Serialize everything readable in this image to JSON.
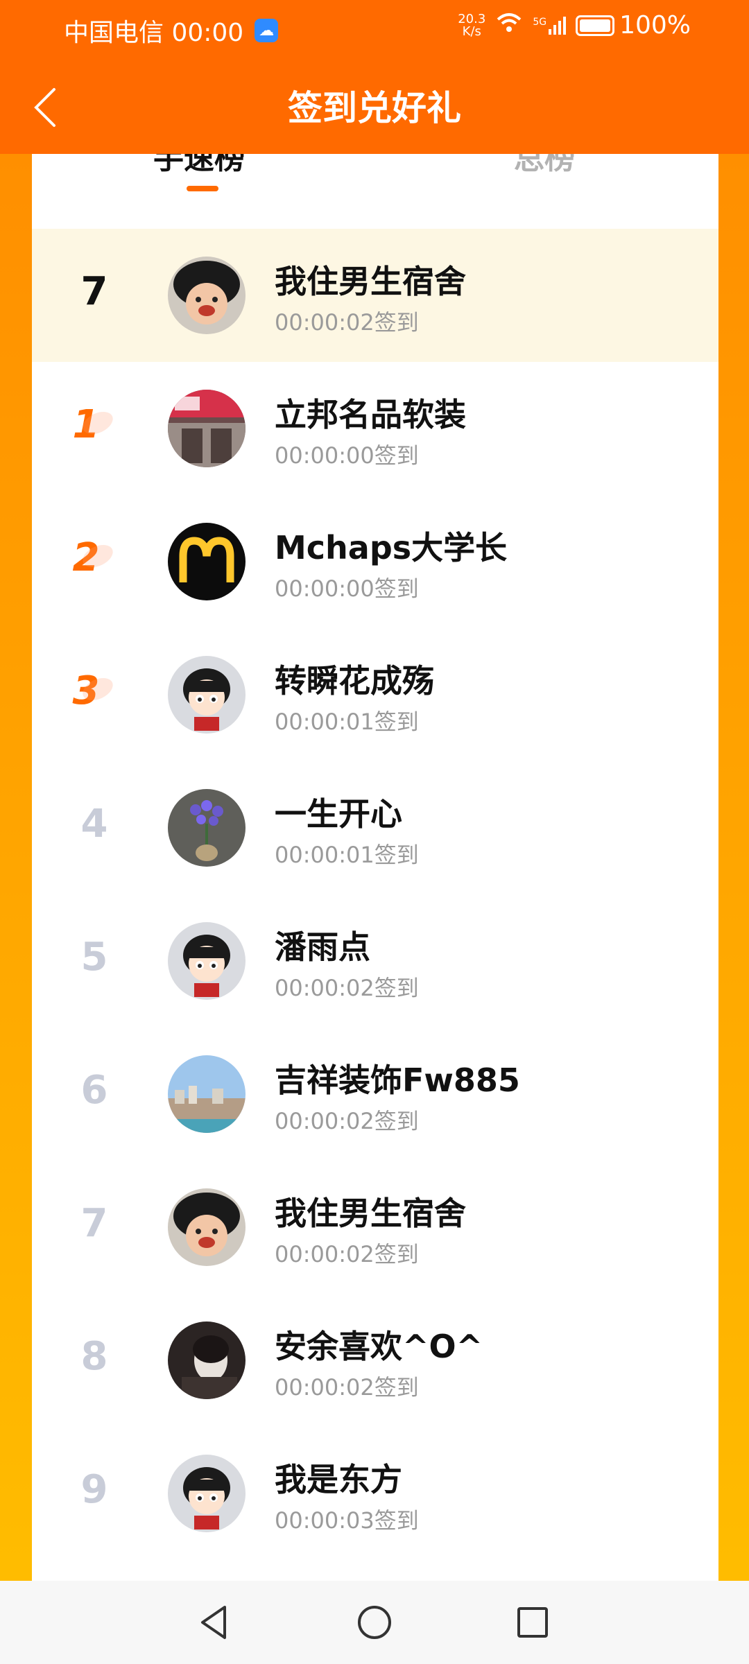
{
  "status_bar": {
    "carrier_time": "中国电信 00:00",
    "net_speed_top": "20.3",
    "net_speed_bottom": "K/s",
    "network_type": "5G",
    "battery": "100%"
  },
  "header": {
    "title": "签到兑好礼"
  },
  "tabs": [
    {
      "label": "手速榜",
      "active": true
    },
    {
      "label": "总榜",
      "active": false
    }
  ],
  "my_rank": {
    "rank": "7",
    "name": "我住男生宿舍",
    "time": "00:00:02签到",
    "avatar": "baby-avatar"
  },
  "leaderboard": [
    {
      "rank": "1",
      "name": "立邦名品软装",
      "time": "00:00:00签到",
      "avatar": "storefront-avatar"
    },
    {
      "rank": "2",
      "name": "Mchaps大学长",
      "time": "00:00:00签到",
      "avatar": "mcdonalds-avatar"
    },
    {
      "rank": "3",
      "name": "转瞬花成殇",
      "time": "00:00:01签到",
      "avatar": "cartoon-avatar"
    },
    {
      "rank": "4",
      "name": "一生开心",
      "time": "00:00:01签到",
      "avatar": "flower-avatar"
    },
    {
      "rank": "5",
      "name": "潘雨点",
      "time": "00:00:02签到",
      "avatar": "cartoon-avatar"
    },
    {
      "rank": "6",
      "name": "吉祥装饰Fw885",
      "time": "00:00:02签到",
      "avatar": "city-avatar"
    },
    {
      "rank": "7",
      "name": "我住男生宿舍",
      "time": "00:00:02签到",
      "avatar": "baby-avatar"
    },
    {
      "rank": "8",
      "name": "安余喜欢^O^",
      "time": "00:00:02签到",
      "avatar": "photo-avatar"
    },
    {
      "rank": "9",
      "name": "我是东方",
      "time": "00:00:03签到",
      "avatar": "cartoon-avatar"
    }
  ],
  "colors": {
    "brand": "#ff6a00",
    "highlight_row": "#fdf7e3",
    "rank_gray": "#c8ccd8"
  }
}
